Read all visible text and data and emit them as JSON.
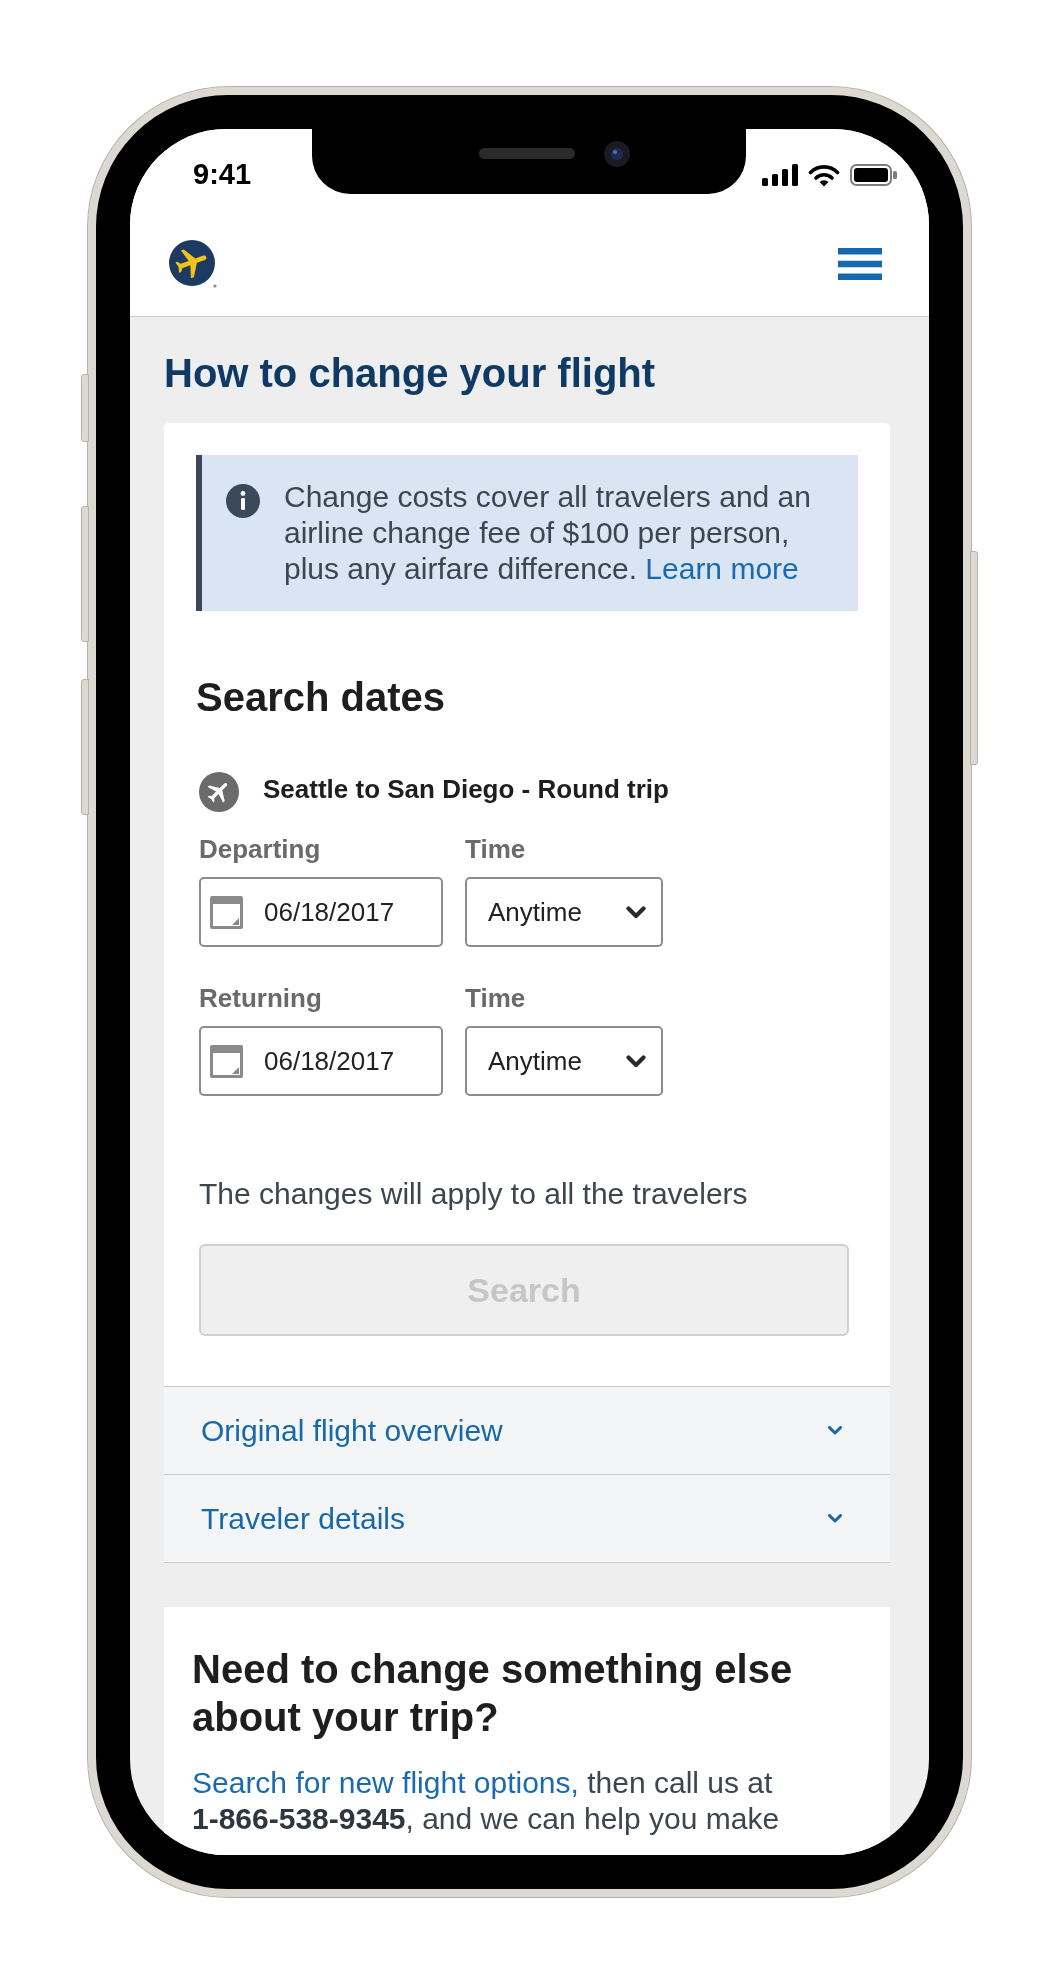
{
  "status_bar": {
    "time": "9:41"
  },
  "page_title": "How to change your flight",
  "info_banner": {
    "text": "Change costs cover all travelers and an airline change fee of $100 per person, plus any airfare difference.",
    "link": "Learn more"
  },
  "search_dates": {
    "title": "Search dates",
    "trip": "Seattle to San Diego - Round trip",
    "legs": [
      {
        "label": "Departing",
        "date": "06/18/2017",
        "time_label": "Time",
        "time": "Anytime"
      },
      {
        "label": "Returning",
        "date": "06/18/2017",
        "time_label": "Time",
        "time": "Anytime"
      }
    ],
    "note": "The changes will apply to all the travelers",
    "search_button": {
      "label": "Search",
      "disabled": true
    }
  },
  "sections": [
    {
      "label": "Original flight overview",
      "expanded": false
    },
    {
      "label": "Traveler details",
      "expanded": false
    }
  ],
  "help": {
    "title": "Need to change something else about your trip?",
    "link": "Search for new flight options,",
    "text": "then call us at **1-866-538-9345**, and we can help you make"
  }
}
